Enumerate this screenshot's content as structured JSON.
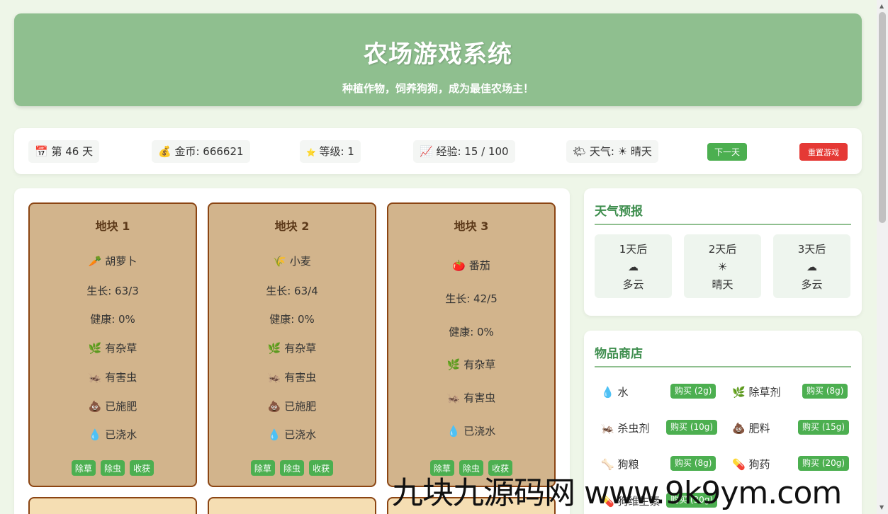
{
  "header": {
    "title": "农场游戏系统",
    "subtitle": "种植作物，饲养狗狗，成为最佳农场主！"
  },
  "status": {
    "day": "第 46 天",
    "day_icon": "📅",
    "coins": "金币: 666621",
    "coins_icon": "💰",
    "level": "等级: 1",
    "level_icon": "⭐",
    "exp": "经验: 15 / 100",
    "exp_icon": "📈",
    "weather": "天气: ☀ 晴天",
    "weather_icon": "🌤",
    "next_day_label": "下一天",
    "reset_label": "重置游戏"
  },
  "plots": [
    {
      "title": "地块 1",
      "crop": "胡萝卜",
      "crop_icon": "🥕",
      "growth": "生长: 63/3",
      "health": "健康: 0%",
      "weeds": "有杂草",
      "weeds_icon": "🌿",
      "pests": "有害虫",
      "pests_icon": "🦗",
      "fertilized": "已施肥",
      "fertilized_icon": "💩",
      "watered": "已浇水",
      "watered_icon": "💧",
      "actions": [
        "除草",
        "除虫",
        "收获"
      ]
    },
    {
      "title": "地块 2",
      "crop": "小麦",
      "crop_icon": "🌾",
      "growth": "生长: 63/4",
      "health": "健康: 0%",
      "weeds": "有杂草",
      "weeds_icon": "🌿",
      "pests": "有害虫",
      "pests_icon": "🦗",
      "fertilized": "已施肥",
      "fertilized_icon": "💩",
      "watered": "已浇水",
      "watered_icon": "💧",
      "actions": [
        "除草",
        "除虫",
        "收获"
      ]
    },
    {
      "title": "地块 3",
      "crop": "番茄",
      "crop_icon": "🍅",
      "growth": "生长: 42/5",
      "health": "健康: 0%",
      "weeds": "有杂草",
      "weeds_icon": "🌿",
      "pests": "有害虫",
      "pests_icon": "🦗",
      "watered": "已浇水",
      "watered_icon": "💧",
      "actions": [
        "除草",
        "除虫",
        "收获"
      ]
    }
  ],
  "forecast": {
    "title": "天气预报",
    "days": [
      {
        "label": "1天后",
        "icon": "☁",
        "weather": "多云"
      },
      {
        "label": "2天后",
        "icon": "☀",
        "weather": "晴天"
      },
      {
        "label": "3天后",
        "icon": "☁",
        "weather": "多云"
      }
    ]
  },
  "shop": {
    "title": "物品商店",
    "items": [
      {
        "icon": "💧",
        "name": "水",
        "button": "购买 (2g)"
      },
      {
        "icon": "🌿",
        "name": "除草剂",
        "button": "购买 (8g)"
      },
      {
        "icon": "🦗",
        "name": "杀虫剂",
        "button": "购买 (10g)"
      },
      {
        "icon": "💩",
        "name": "肥料",
        "button": "购买 (15g)"
      },
      {
        "icon": "🦴",
        "name": "狗粮",
        "button": "购买 (8g)"
      },
      {
        "icon": "💊",
        "name": "狗药",
        "button": "购买 (20g)"
      },
      {
        "icon": "💊",
        "name": "狗维生素",
        "button": "购买 (30g)"
      }
    ]
  },
  "watermark": "九块九源码网 www.9k9ym.com"
}
